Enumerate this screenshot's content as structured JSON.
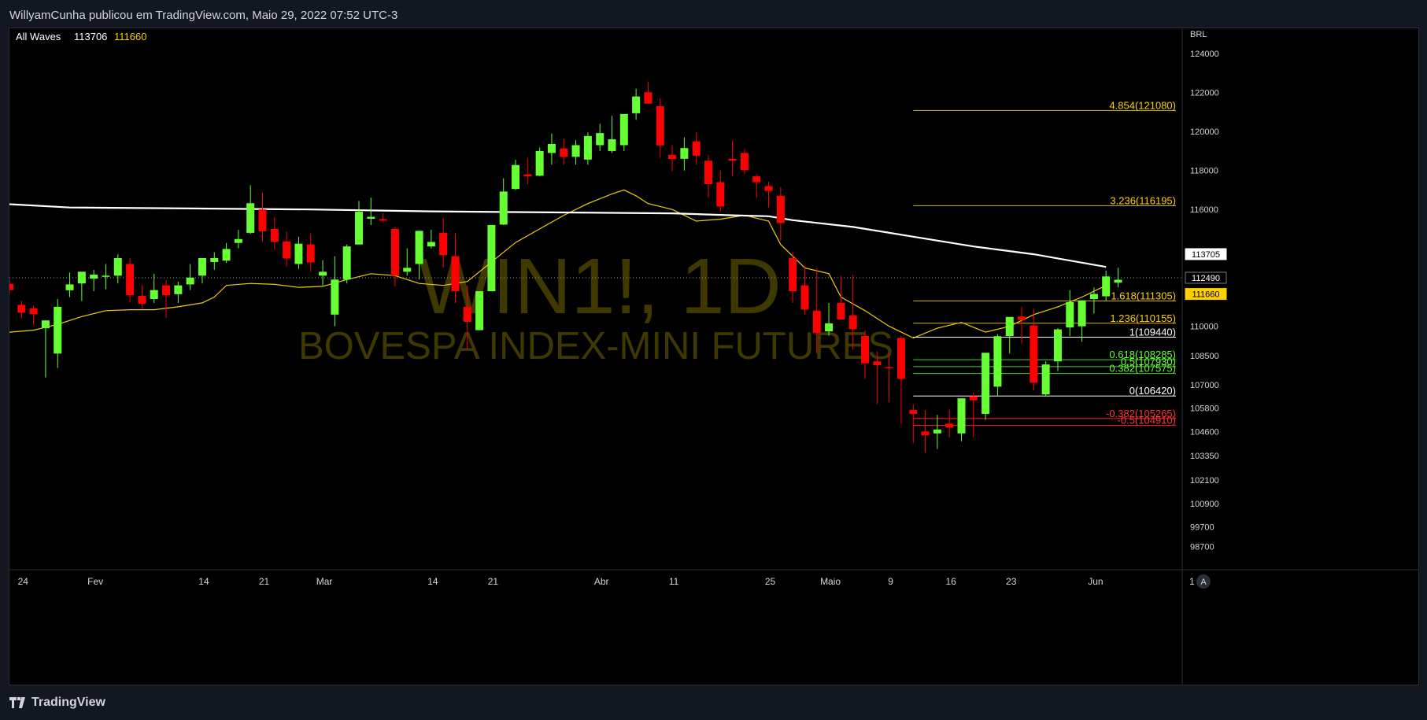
{
  "header": {
    "publisher_line": "WillyamCunha publicou em TradingView.com, Maio 29, 2022 07:52 UTC-3"
  },
  "footer": {
    "brand": "TradingView"
  },
  "colors": {
    "background": "#000000",
    "frame": "#131722",
    "bull": "#66ff33",
    "bear": "#ff0000",
    "fib_gold": "#d4b32b",
    "fib_green": "#4cd137",
    "fib_red": "#ff2222",
    "ma_fast": "#f0d000",
    "ma_slow": "#ffffff",
    "watermark": "#4a4400"
  },
  "chart_data": {
    "type": "candlestick",
    "symbol_line": "WIN1!, 1D",
    "symbol_name": "BOVESPA INDEX-MINI FUTURES",
    "legend": {
      "name": "All Waves",
      "value1": "113706",
      "value2": "111660"
    },
    "currency": "BRL",
    "ylim": [
      97500,
      125300
    ],
    "y_ticks": [
      {
        "value": 124000,
        "label": "124000"
      },
      {
        "value": 122000,
        "label": "122000"
      },
      {
        "value": 120000,
        "label": "120000"
      },
      {
        "value": 118000,
        "label": "118000"
      },
      {
        "value": 116000,
        "label": "116000"
      },
      {
        "value": 110000,
        "label": "110000"
      },
      {
        "value": 108500,
        "label": "108500"
      },
      {
        "value": 107000,
        "label": "107000"
      },
      {
        "value": 105800,
        "label": "105800"
      },
      {
        "value": 104600,
        "label": "104600"
      },
      {
        "value": 103350,
        "label": "103350"
      },
      {
        "value": 102100,
        "label": "102100"
      },
      {
        "value": 100900,
        "label": "100900"
      },
      {
        "value": 99700,
        "label": "99700"
      },
      {
        "value": 98700,
        "label": "98700"
      }
    ],
    "x_ticks": [
      {
        "index": 1,
        "label": "24"
      },
      {
        "index": 7,
        "label": "Fev"
      },
      {
        "index": 16,
        "label": "14"
      },
      {
        "index": 21,
        "label": "21"
      },
      {
        "index": 26,
        "label": "Mar"
      },
      {
        "index": 35,
        "label": "14"
      },
      {
        "index": 40,
        "label": "21"
      },
      {
        "index": 49,
        "label": "Abr"
      },
      {
        "index": 55,
        "label": "11"
      },
      {
        "index": 63,
        "label": "25"
      },
      {
        "index": 68,
        "label": "Maio"
      },
      {
        "index": 73,
        "label": "9"
      },
      {
        "index": 78,
        "label": "16"
      },
      {
        "index": 83,
        "label": "23"
      },
      {
        "index": 90,
        "label": "Jun"
      },
      {
        "index": 98,
        "label": "1"
      }
    ],
    "candles": [
      [
        112180,
        112400,
        111640,
        111860
      ],
      [
        111100,
        111300,
        110400,
        110700
      ],
      [
        110920,
        111060,
        110070,
        110620
      ],
      [
        109900,
        110200,
        107370,
        110300
      ],
      [
        108600,
        111400,
        107860,
        111000
      ],
      [
        111850,
        112760,
        111500,
        112150
      ],
      [
        112200,
        112700,
        111300,
        112800
      ],
      [
        112450,
        112900,
        111800,
        112650
      ],
      [
        112550,
        113200,
        111900,
        112600
      ],
      [
        112600,
        113700,
        112200,
        113500
      ],
      [
        113200,
        113500,
        111220,
        111600
      ],
      [
        111560,
        112120,
        110920,
        111160
      ],
      [
        111400,
        112700,
        111200,
        111860
      ],
      [
        112100,
        112360,
        110440,
        111600
      ],
      [
        111650,
        112300,
        111200,
        112100
      ],
      [
        112150,
        113200,
        111860,
        112500
      ],
      [
        112600,
        113400,
        112200,
        113500
      ],
      [
        113300,
        113800,
        112900,
        113500
      ],
      [
        113370,
        114280,
        113260,
        113970
      ],
      [
        114280,
        114950,
        114000,
        114480
      ],
      [
        114800,
        117240,
        114740,
        116320
      ],
      [
        116000,
        116850,
        114360,
        114880
      ],
      [
        115000,
        115620,
        113940,
        114350
      ],
      [
        114360,
        114860,
        113070,
        113480
      ],
      [
        113200,
        114600,
        112950,
        114240
      ],
      [
        114200,
        114770,
        112800,
        113280
      ],
      [
        112600,
        113400,
        112100,
        112800
      ],
      [
        110600,
        113600,
        110000,
        112400
      ],
      [
        112400,
        114200,
        112200,
        114100
      ],
      [
        114200,
        116440,
        114200,
        115880
      ],
      [
        115520,
        116600,
        115200,
        115620
      ],
      [
        115500,
        115800,
        115400,
        115420
      ],
      [
        115000,
        115100,
        112050,
        112600
      ],
      [
        112800,
        114000,
        112600,
        113000
      ],
      [
        113200,
        114900,
        112400,
        114900
      ],
      [
        114100,
        114960,
        114000,
        114330
      ],
      [
        114800,
        115560,
        113000,
        113650
      ],
      [
        113600,
        114800,
        111200,
        111800
      ],
      [
        111000,
        112100,
        108830,
        110230
      ],
      [
        109800,
        111200,
        109800,
        111800
      ],
      [
        111800,
        115200,
        111800,
        115200
      ],
      [
        115220,
        117600,
        115200,
        116920
      ],
      [
        117050,
        118550,
        117000,
        118280
      ],
      [
        117800,
        118650,
        117300,
        117700
      ],
      [
        117730,
        119180,
        117710,
        119000
      ],
      [
        118900,
        119900,
        118300,
        119360
      ],
      [
        119130,
        119640,
        118300,
        118700
      ],
      [
        118700,
        119560,
        118300,
        119300
      ],
      [
        118560,
        119950,
        118300,
        119770
      ],
      [
        119300,
        120400,
        119000,
        119920
      ],
      [
        119000,
        120800,
        118900,
        119600
      ],
      [
        119300,
        120800,
        119000,
        120900
      ],
      [
        120940,
        122200,
        120600,
        121800
      ],
      [
        122020,
        122550,
        121700,
        121430
      ],
      [
        121300,
        121700,
        118650,
        119290
      ],
      [
        118800,
        119300,
        117960,
        118590
      ],
      [
        118600,
        119700,
        118000,
        119150
      ],
      [
        119500,
        119960,
        118300,
        118760
      ],
      [
        118500,
        118800,
        116600,
        117300
      ],
      [
        117400,
        118000,
        115900,
        116150
      ],
      [
        118600,
        119540,
        117700,
        118500
      ],
      [
        118900,
        119100,
        117800,
        118020
      ],
      [
        117700,
        117800,
        116600,
        117400
      ],
      [
        117200,
        117420,
        116100,
        116950
      ],
      [
        116700,
        117150,
        114400,
        115300
      ],
      [
        113500,
        113800,
        111200,
        111800
      ],
      [
        112100,
        113100,
        110600,
        110860
      ],
      [
        110800,
        113000,
        108620,
        109650
      ],
      [
        109740,
        111200,
        109520,
        110150
      ],
      [
        111200,
        112600,
        110600,
        110350
      ],
      [
        110560,
        112650,
        108800,
        109850
      ],
      [
        109500,
        109800,
        107300,
        108100
      ],
      [
        108200,
        108700,
        106000,
        108000
      ],
      [
        107900,
        108600,
        106100,
        107840
      ],
      [
        109400,
        109500,
        105000,
        107300
      ],
      [
        105700,
        106000,
        104000,
        105500
      ],
      [
        104600,
        105700,
        103500,
        104400
      ],
      [
        104500,
        105450,
        103700,
        104700
      ],
      [
        105000,
        105720,
        104300,
        104800
      ],
      [
        104500,
        104680,
        104100,
        106300
      ],
      [
        106410,
        106600,
        104300,
        106200
      ],
      [
        105500,
        108200,
        105200,
        108640
      ],
      [
        106900,
        109600,
        106400,
        109490
      ],
      [
        109500,
        110200,
        108600,
        110480
      ],
      [
        110500,
        111000,
        109100,
        110320
      ],
      [
        110040,
        110900,
        106700,
        107100
      ],
      [
        106500,
        108200,
        106400,
        108040
      ],
      [
        108200,
        109900,
        107700,
        109840
      ],
      [
        109940,
        111860,
        109500,
        111240
      ],
      [
        110000,
        111100,
        109200,
        111330
      ],
      [
        111400,
        112000,
        110660,
        111660
      ],
      [
        111540,
        112860,
        111300,
        112560
      ],
      [
        112240,
        113000,
        112000,
        112390
      ]
    ],
    "series": [
      {
        "name": "",
        "color_key": "ma_fast",
        "points": [
          [
            -1,
            109500
          ],
          [
            0,
            109700
          ],
          [
            2,
            109800
          ],
          [
            4,
            110100
          ],
          [
            6,
            110500
          ],
          [
            8,
            110800
          ],
          [
            10,
            110850
          ],
          [
            12,
            110850
          ],
          [
            14,
            111000
          ],
          [
            16,
            111200
          ],
          [
            17,
            111500
          ],
          [
            18,
            112100
          ],
          [
            20,
            112200
          ],
          [
            22,
            112150
          ],
          [
            24,
            112000
          ],
          [
            26,
            112050
          ],
          [
            28,
            112400
          ],
          [
            30,
            112700
          ],
          [
            32,
            112600
          ],
          [
            34,
            112200
          ],
          [
            36,
            112100
          ],
          [
            38,
            112300
          ],
          [
            40,
            113300
          ],
          [
            42,
            114300
          ],
          [
            44,
            115000
          ],
          [
            46,
            115700
          ],
          [
            48,
            116300
          ],
          [
            50,
            116800
          ],
          [
            51,
            117000
          ],
          [
            52,
            116700
          ],
          [
            53,
            116300
          ],
          [
            55,
            116000
          ],
          [
            57,
            115400
          ],
          [
            59,
            115500
          ],
          [
            61,
            115700
          ],
          [
            63,
            115400
          ],
          [
            64,
            114200
          ],
          [
            66,
            113000
          ],
          [
            68,
            112700
          ],
          [
            69,
            111500
          ],
          [
            71,
            110800
          ],
          [
            73,
            110000
          ],
          [
            75,
            109400
          ],
          [
            77,
            109900
          ],
          [
            79,
            110200
          ],
          [
            81,
            109700
          ],
          [
            83,
            110000
          ],
          [
            85,
            110600
          ],
          [
            87,
            111000
          ],
          [
            89,
            111500
          ],
          [
            91,
            112100
          ]
        ]
      },
      {
        "name": "",
        "color_key": "ma_slow",
        "points": [
          [
            -1,
            116300
          ],
          [
            5,
            116100
          ],
          [
            15,
            116050
          ],
          [
            25,
            116000
          ],
          [
            35,
            115900
          ],
          [
            45,
            115850
          ],
          [
            55,
            115800
          ],
          [
            60,
            115700
          ],
          [
            63,
            115650
          ],
          [
            65,
            115450
          ],
          [
            70,
            115100
          ],
          [
            75,
            114600
          ],
          [
            80,
            114100
          ],
          [
            85,
            113700
          ],
          [
            91,
            113050
          ]
        ]
      }
    ],
    "fib_levels": [
      {
        "label": "4.854(121080)",
        "value": 121080,
        "color_key": "fib_gold",
        "label_color": "#ffd000",
        "x_from": 75
      },
      {
        "label": "3.236(116195)",
        "value": 116195,
        "color_key": "fib_gold",
        "label_color": "#ffd000",
        "x_from": 75
      },
      {
        "label": "1.618(111305)",
        "value": 111305,
        "color_key": "fib_gold",
        "label_color": "#ffd000",
        "x_from": 75
      },
      {
        "label": "1.236(110155)",
        "value": 110155,
        "color_key": "fib_gold",
        "label_color": "#ffd000",
        "x_from": 75
      },
      {
        "label": "1(109440)",
        "value": 109440,
        "color_key": "ma_slow",
        "label_color": "#ffffff",
        "x_from": 75
      },
      {
        "label": "0.618(108285)",
        "value": 108285,
        "color_key": "fib_green",
        "label_color": "#66ff33",
        "x_from": 75
      },
      {
        "label": "0.5(107930)",
        "value": 107930,
        "color_key": "fib_green",
        "label_color": "#66ff33",
        "x_from": 75
      },
      {
        "label": "0.382(107575)",
        "value": 107575,
        "color_key": "fib_green",
        "label_color": "#66ff33",
        "x_from": 75
      },
      {
        "label": "0(106420)",
        "value": 106420,
        "color_key": "ma_slow",
        "label_color": "#ffffff",
        "x_from": 75
      },
      {
        "label": "-0.382(105265)",
        "value": 105265,
        "color_key": "fib_red",
        "label_color": "#ff3333",
        "x_from": 75
      },
      {
        "label": "-0.5(104910)",
        "value": 104910,
        "color_key": "fib_red",
        "label_color": "#ff3333",
        "x_from": 75
      }
    ],
    "price_tags": [
      {
        "label": "113705",
        "value": 113705,
        "bg": "#ffffff",
        "fg": "#000000",
        "border": "#ffffff"
      },
      {
        "label": "112490",
        "value": 112490,
        "bg": "#000000",
        "fg": "#ffffff",
        "border": "#787b86"
      },
      {
        "label": "111660",
        "value": 111660,
        "bg": "#ffd000",
        "fg": "#000000",
        "border": "#ffd000"
      }
    ],
    "last_price": 112490
  }
}
